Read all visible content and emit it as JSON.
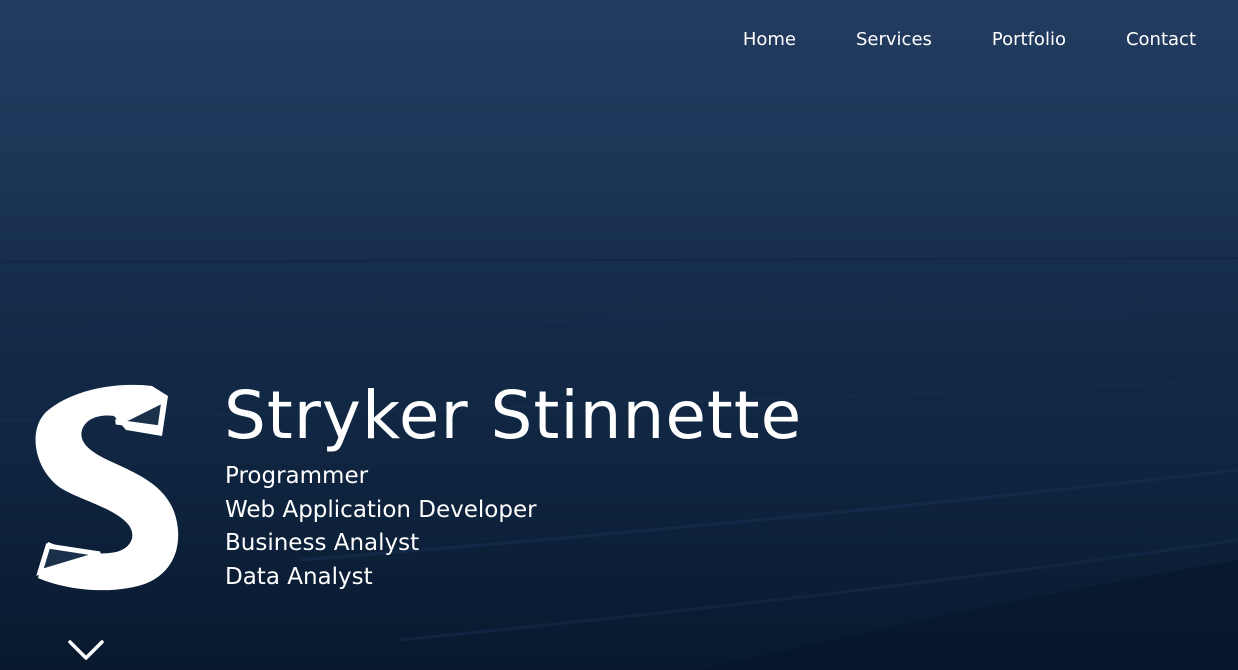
{
  "nav": {
    "items": [
      {
        "label": "Home"
      },
      {
        "label": "Services"
      },
      {
        "label": "Portfolio"
      },
      {
        "label": "Contact"
      }
    ]
  },
  "hero": {
    "logo_icon": "s-logo-icon",
    "name": "Stryker Stinnette",
    "roles": [
      "Programmer",
      "Web Application Developer",
      "Business Analyst",
      "Data Analyst"
    ],
    "scroll_icon": "chevron-down-icon"
  },
  "colors": {
    "background_top": "#223c60",
    "background_bottom": "#0a1c33",
    "text": "#ffffff"
  }
}
